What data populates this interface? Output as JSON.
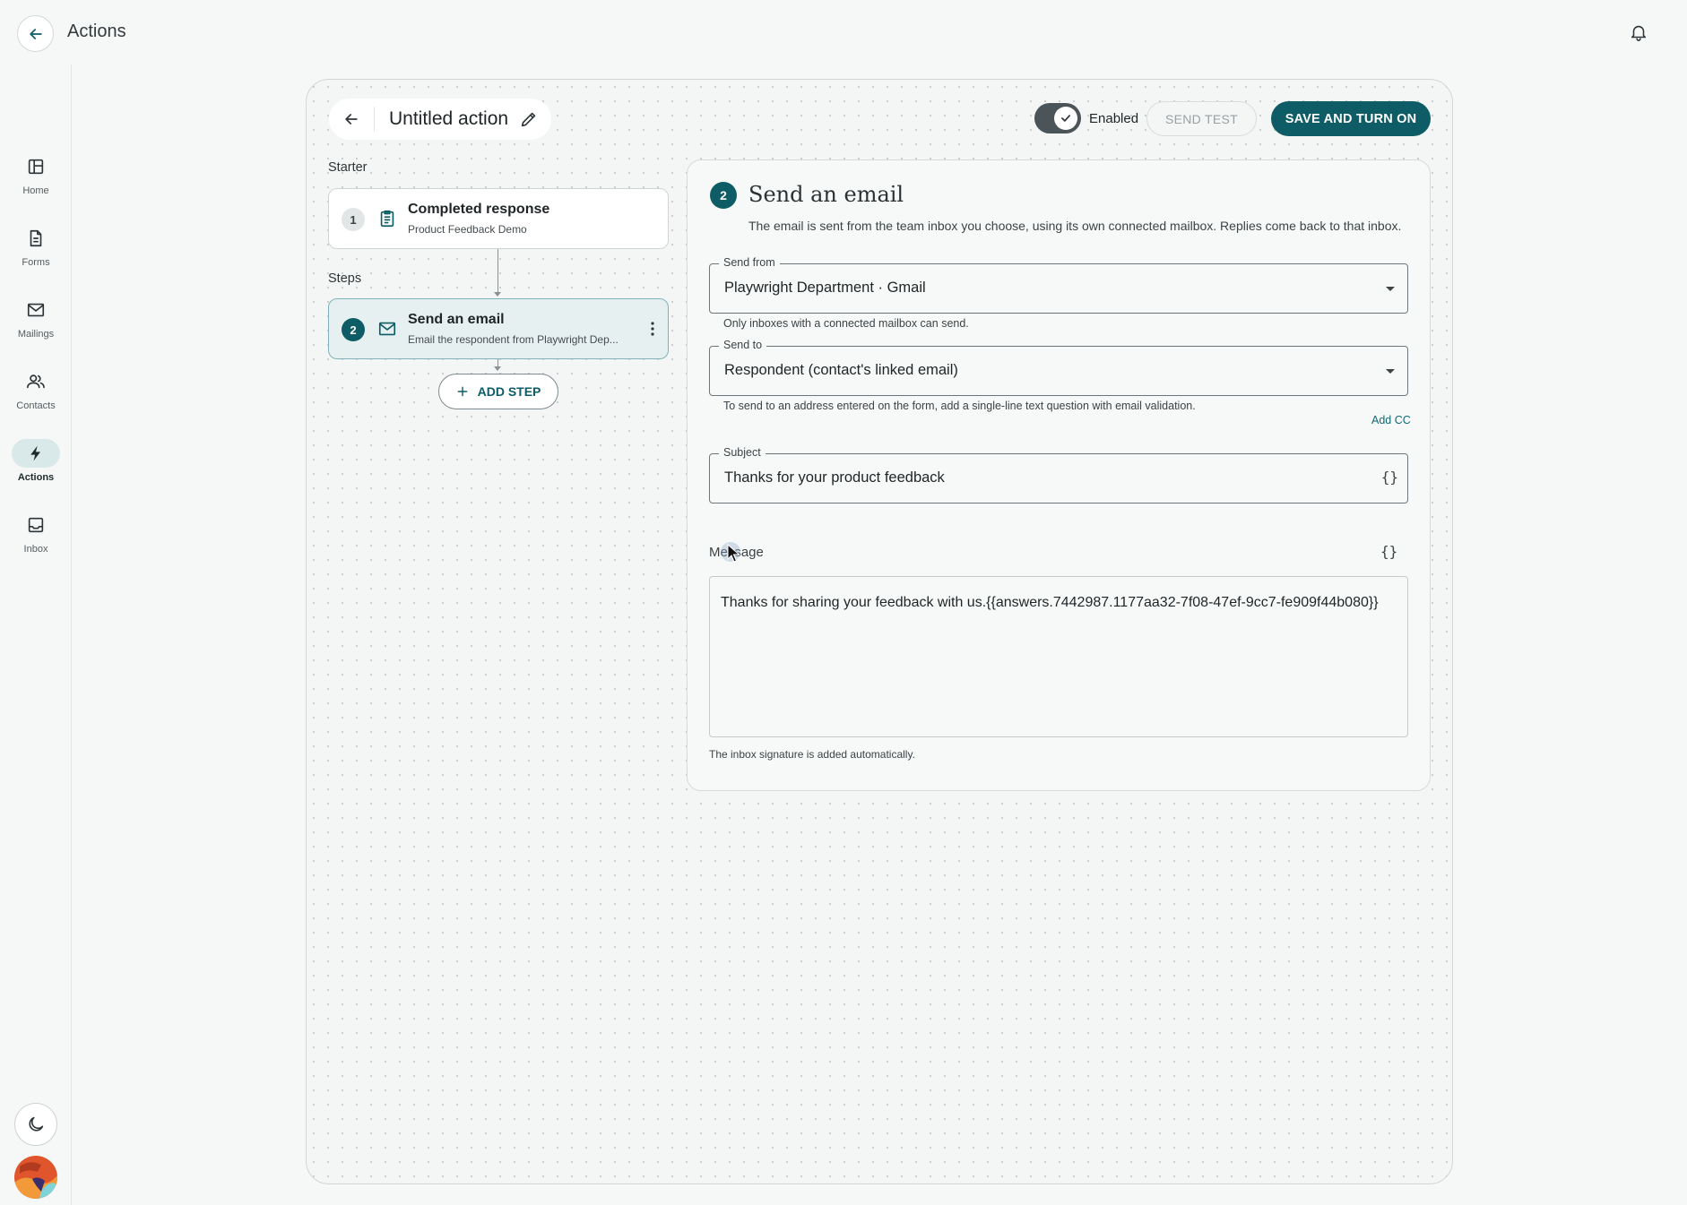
{
  "header": {
    "title": "Actions"
  },
  "nav": {
    "items": [
      {
        "label": "Home",
        "icon": "home-icon"
      },
      {
        "label": "Forms",
        "icon": "document-icon"
      },
      {
        "label": "Mailings",
        "icon": "mail-icon"
      },
      {
        "label": "Contacts",
        "icon": "contacts-icon"
      },
      {
        "label": "Actions",
        "icon": "lightning-icon",
        "active": true
      },
      {
        "label": "Inbox",
        "icon": "inbox-icon"
      }
    ]
  },
  "action": {
    "name": "Untitled action",
    "toggle_label": "Enabled",
    "toggle_on": true,
    "send_test_label": "SEND TEST",
    "save_label": "SAVE AND TURN ON"
  },
  "flow": {
    "starter_label": "Starter",
    "steps_label": "Steps",
    "starter": {
      "number": "1",
      "title": "Completed response",
      "subtitle": "Product Feedback Demo",
      "icon": "clipboard-icon"
    },
    "steps": [
      {
        "number": "2",
        "title": "Send an email",
        "subtitle": "Email the respondent from Playwright Dep...",
        "icon": "mail-icon"
      }
    ],
    "add_step_label": "ADD STEP"
  },
  "editor": {
    "step_number": "2",
    "title": "Send an email",
    "description": "The email is sent from the team inbox you choose, using its own connected mailbox. Replies come back to that inbox.",
    "send_from": {
      "label": "Send from",
      "value": "Playwright Department · Gmail",
      "helper": "Only inboxes with a connected mailbox can send."
    },
    "send_to": {
      "label": "Send to",
      "value": "Respondent (contact's linked email)",
      "helper": "To send to an address entered on the form, add a single-line text question with email validation."
    },
    "add_cc_label": "Add CC",
    "subject": {
      "label": "Subject",
      "value": "Thanks for your product feedback",
      "insert_icon": "{}"
    },
    "message": {
      "label": "Message",
      "insert_icon": "{}",
      "value": "Thanks for sharing your feedback with us.{{answers.7442987.1177aa32-7f08-47ef-9cc7-fe909f44b080}}"
    },
    "signature_note": "The inbox signature is added automatically."
  },
  "colors": {
    "accent": "#0d5c66",
    "selected_bg": "#e6f0f1",
    "nav_active_bg": "#d9e9ea"
  }
}
